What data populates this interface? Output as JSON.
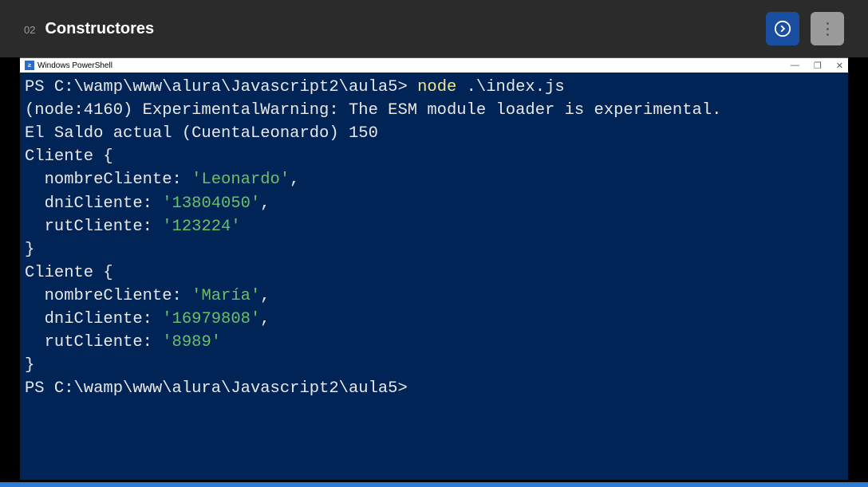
{
  "header": {
    "lesson_number": "02",
    "lesson_title": "Constructores"
  },
  "window": {
    "title": "Windows PowerShell",
    "minimize": "—",
    "maximize": "❐",
    "close": "✕"
  },
  "terminal": {
    "prompt1_ps": "PS ",
    "prompt1_path": "C:\\wamp\\www\\alura\\Javascript2\\aula5> ",
    "cmd_node": "node ",
    "cmd_arg": ".\\index.js",
    "warn_line": "(node:4160) ExperimentalWarning: The ESM module loader is experimental.",
    "saldo_line": "El Saldo actual (CuentaLeonardo) 150",
    "cliente_open": "Cliente {",
    "nombre_label": "  nombreCliente: ",
    "dni_label": "  dniCliente: ",
    "rut_label": "  rutCliente: ",
    "brace_close": "}",
    "c1_nombre": "'Leonardo'",
    "c1_dni": "'13804050'",
    "c1_rut": "'123224'",
    "c2_nombre": "'María'",
    "c2_dni": "'16979808'",
    "c2_rut": "'8989'",
    "comma": ",",
    "prompt2_ps": "PS ",
    "prompt2_path": "C:\\wamp\\www\\alura\\Javascript2\\aula5> "
  }
}
